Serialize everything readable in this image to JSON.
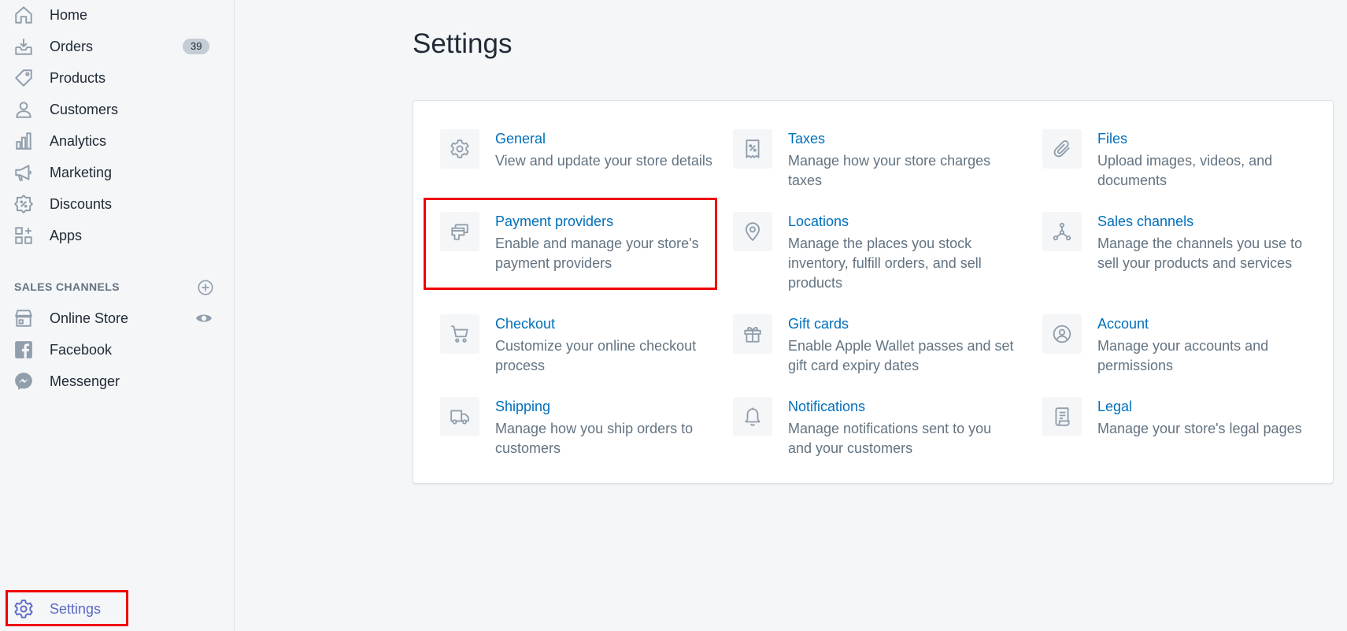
{
  "sidebar": {
    "items": [
      {
        "label": "Home",
        "icon": "home-icon"
      },
      {
        "label": "Orders",
        "icon": "orders-icon",
        "badge": "39"
      },
      {
        "label": "Products",
        "icon": "tag-icon"
      },
      {
        "label": "Customers",
        "icon": "person-icon"
      },
      {
        "label": "Analytics",
        "icon": "bar-chart-icon"
      },
      {
        "label": "Marketing",
        "icon": "megaphone-icon"
      },
      {
        "label": "Discounts",
        "icon": "discount-icon"
      },
      {
        "label": "Apps",
        "icon": "apps-icon"
      }
    ],
    "sales_channels": {
      "heading": "SALES CHANNELS",
      "items": [
        {
          "label": "Online Store",
          "icon": "store-icon"
        },
        {
          "label": "Facebook",
          "icon": "facebook-icon"
        },
        {
          "label": "Messenger",
          "icon": "messenger-icon"
        }
      ]
    },
    "settings": {
      "label": "Settings",
      "icon": "gear-icon"
    }
  },
  "main": {
    "title": "Settings",
    "settings_items": [
      {
        "title": "General",
        "description": "View and update your store details",
        "icon": "gear-icon"
      },
      {
        "title": "Taxes",
        "description": "Manage how your store charges taxes",
        "icon": "tax-receipt-icon"
      },
      {
        "title": "Files",
        "description": "Upload images, videos, and documents",
        "icon": "paperclip-icon"
      },
      {
        "title": "Payment providers",
        "description": "Enable and manage your store's payment providers",
        "icon": "payment-icon"
      },
      {
        "title": "Locations",
        "description": "Manage the places you stock inventory, fulfill orders, and sell products",
        "icon": "location-pin-icon"
      },
      {
        "title": "Sales channels",
        "description": "Manage the channels you use to sell your products and services",
        "icon": "channels-icon"
      },
      {
        "title": "Checkout",
        "description": "Customize your online checkout process",
        "icon": "cart-icon"
      },
      {
        "title": "Gift cards",
        "description": "Enable Apple Wallet passes and set gift card expiry dates",
        "icon": "gift-icon"
      },
      {
        "title": "Account",
        "description": "Manage your accounts and permissions",
        "icon": "account-icon"
      },
      {
        "title": "Shipping",
        "description": "Manage how you ship orders to customers",
        "icon": "truck-icon"
      },
      {
        "title": "Notifications",
        "description": "Manage notifications sent to you and your customers",
        "icon": "bell-icon"
      },
      {
        "title": "Legal",
        "description": "Manage your store's legal pages",
        "icon": "legal-scroll-icon"
      }
    ]
  },
  "colors": {
    "accent": "#5c6ac4",
    "link": "#006fbb",
    "highlight": "#ee0000",
    "muted_text": "#637381",
    "icon": "#919eab"
  }
}
